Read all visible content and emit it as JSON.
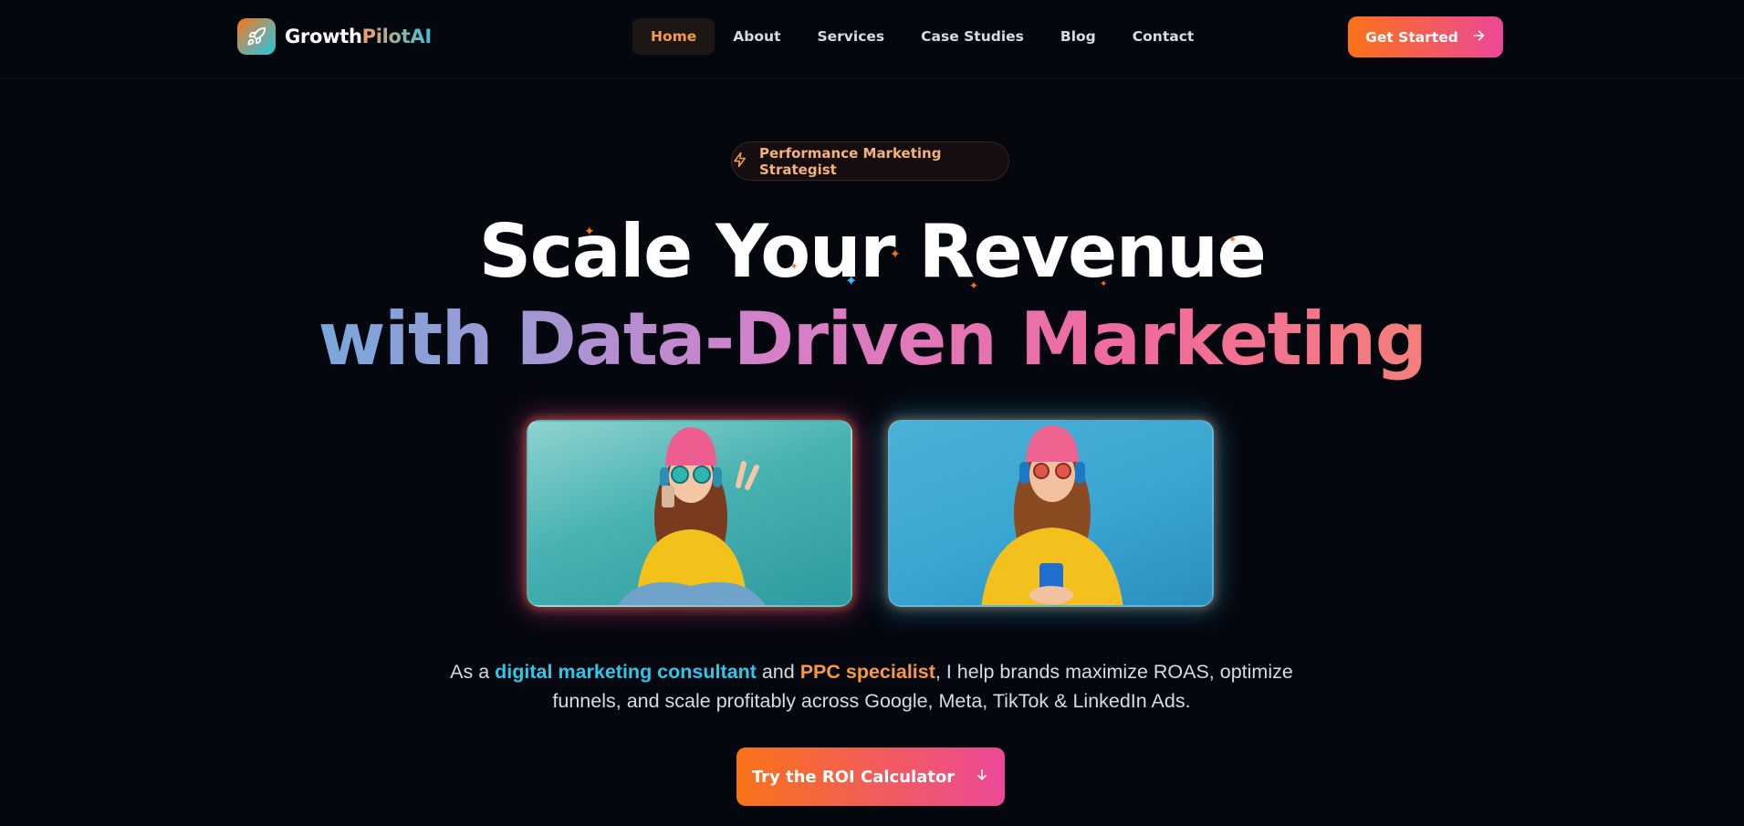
{
  "brand": {
    "name_part1": "Growth",
    "name_part2": "PilotAI",
    "icon": "rocket-icon"
  },
  "nav": {
    "items": [
      {
        "label": "Home",
        "active": true
      },
      {
        "label": "About"
      },
      {
        "label": "Services"
      },
      {
        "label": "Case Studies"
      },
      {
        "label": "Blog"
      },
      {
        "label": "Contact"
      }
    ],
    "cta_label": "Get Started",
    "cta_icon": "arrow-right-icon"
  },
  "hero": {
    "badge_label": "Performance Marketing Strategist",
    "badge_icon": "lightning-icon",
    "headline_line1": "Scale Your Revenue",
    "headline_line2": "with Data-Driven Marketing",
    "paragraph": {
      "part1": "As a ",
      "highlight1": "digital marketing consultant",
      "part2": " and ",
      "highlight2": "PPC specialist",
      "part3": ", I help brands maximize ROAS, optimize funnels, and scale profitably across Google, Meta, TikTok & LinkedIn Ads."
    },
    "cta_label": "Try the ROI Calculator",
    "cta_icon": "arrow-down-icon"
  },
  "colors": {
    "background": "#05070f",
    "accent_orange": "#f97316",
    "accent_pink": "#ec4899",
    "accent_cyan": "#30c6e8"
  }
}
